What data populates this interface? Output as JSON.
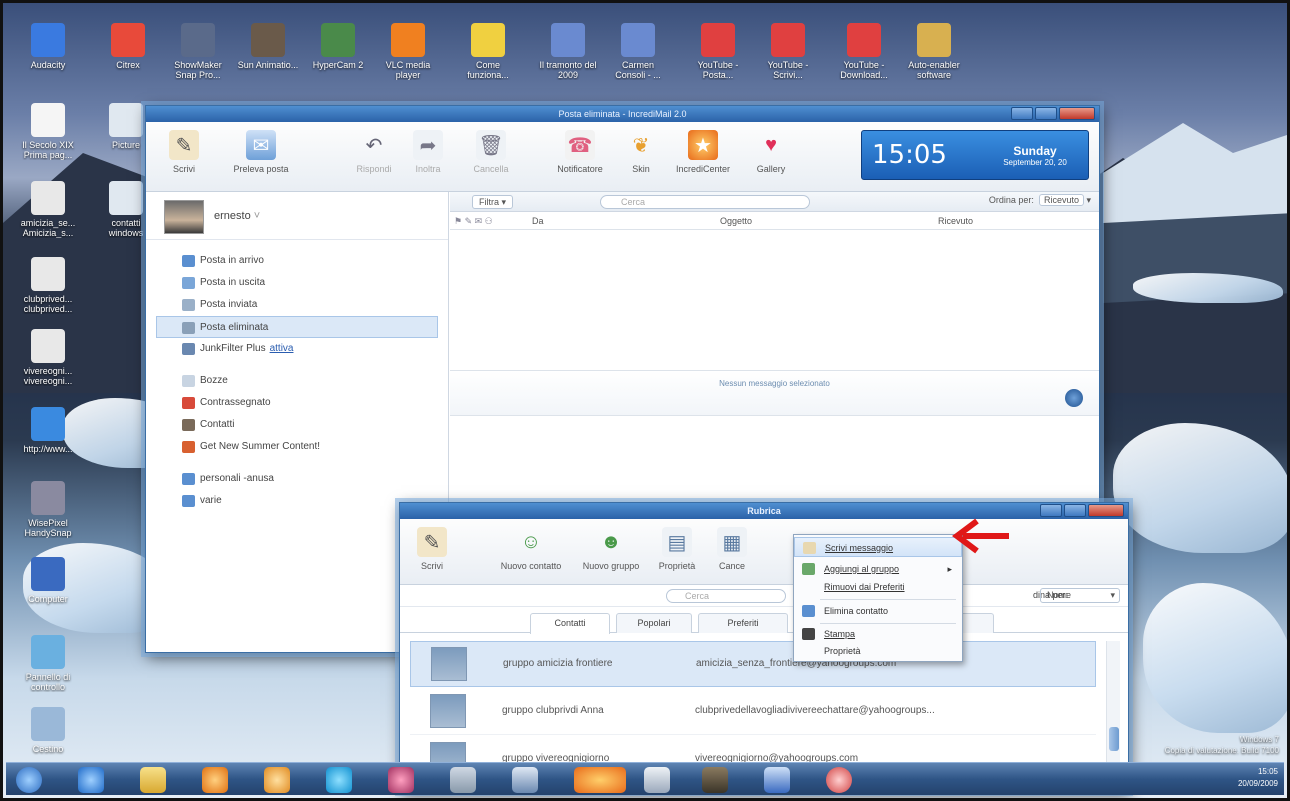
{
  "desktop_icons": [
    {
      "name": "audacity-icon",
      "label": "Audacity"
    },
    {
      "name": "citrex-icon",
      "label": "Citrex"
    },
    {
      "name": "snapshot-icon",
      "label": "ShowMaker Snap Pro..."
    },
    {
      "name": "video-icon",
      "label": "Sun Animatio..."
    },
    {
      "name": "hypercam-icon",
      "label": "HyperCam 2"
    },
    {
      "name": "vlc-icon",
      "label": "VLC media player"
    },
    {
      "name": "shortcut-1-icon",
      "label": "Come funziona..."
    },
    {
      "name": "wav-icon",
      "label": "Il tramonto del 2009"
    },
    {
      "name": "mp3-icon",
      "label": "Carmen Consoli - ..."
    },
    {
      "name": "youtube-1-icon",
      "label": "YouTube - Posta..."
    },
    {
      "name": "youtube-2-icon",
      "label": "YouTube - Scrivi..."
    },
    {
      "name": "youtube-3-icon",
      "label": "YouTube - Download..."
    },
    {
      "name": "folder-icon",
      "label": "Auto-enabler software"
    },
    {
      "name": "document-icon",
      "label": "Il Secolo XIX Prima pag..."
    },
    {
      "name": "picture-icon",
      "label": "Picture"
    },
    {
      "name": "shortcut-amicizia-icon",
      "label": "amicizia_se... Amicizia_s..."
    },
    {
      "name": "contatti-icon",
      "label": "contatti windows"
    },
    {
      "name": "clubprived-icon",
      "label": "clubprived... clubprived..."
    },
    {
      "name": "vivereogni-icon",
      "label": "vivereogni... vivereogni..."
    },
    {
      "name": "ie-icon",
      "label": "http://www..."
    },
    {
      "name": "wisepixel-icon",
      "label": "WisePixel HandySnap"
    },
    {
      "name": "computer-icon",
      "label": "Computer"
    },
    {
      "name": "control-panel-icon",
      "label": "Pannello di controllo"
    },
    {
      "name": "recycle-bin-icon",
      "label": "Cestino"
    }
  ],
  "mail_window": {
    "title": "Posta eliminata - IncrediMail 2.0",
    "toolbar": {
      "write": "Scrivi",
      "receive": "Preleva posta",
      "reply": "Rispondi",
      "forward": "Inoltra",
      "delete": "Cancella",
      "notifier": "Notificatore",
      "skin": "Skin",
      "incredicenter": "IncrediCenter",
      "gallery": "Gallery"
    },
    "clock": {
      "time": "15:05",
      "day": "Sunday",
      "date": "September 20, 20"
    },
    "account_name": "ernesto",
    "folders": [
      {
        "label": "Posta in arrivo",
        "icon": "inbox-icon",
        "color": "#5a8fd0"
      },
      {
        "label": "Posta in uscita",
        "icon": "outbox-icon",
        "color": "#7aa6d8"
      },
      {
        "label": "Posta inviata",
        "icon": "sent-icon",
        "color": "#9ab0c8"
      },
      {
        "label": "Posta eliminata",
        "icon": "trash-icon",
        "color": "#8aa0b8"
      },
      {
        "label": "JunkFilter Plus",
        "icon": "junk-icon",
        "color": "#6a88b0",
        "link": "attiva"
      }
    ],
    "folders2": [
      {
        "label": "Bozze",
        "icon": "drafts-icon",
        "color": "#c8d4e2"
      },
      {
        "label": "Contrassegnato",
        "icon": "flag-icon",
        "color": "#d84a3a"
      },
      {
        "label": "Contatti",
        "icon": "contacts-icon",
        "color": "#7a6a5a"
      },
      {
        "label": "Get New Summer Content!",
        "icon": "summer-icon",
        "color": "#d86030"
      }
    ],
    "folders3": [
      {
        "label": "personali -anusa",
        "icon": "folder-personal-icon",
        "color": "#5a8fd0"
      },
      {
        "label": "varie",
        "icon": "folder-varie-icon",
        "color": "#5a8fd0"
      }
    ],
    "filter_label": "Filtra",
    "search_placeholder": "Cerca",
    "sort_label": "Ordina per:",
    "sort_value": "Ricevuto",
    "columns": {
      "from": "Da",
      "subject": "Oggetto",
      "received": "Ricevuto"
    },
    "empty_message": "Nessun messaggio selezionato"
  },
  "address_book": {
    "title": "Rubrica",
    "toolbar": {
      "write": "Scrivi",
      "new_contact": "Nuovo contatto",
      "new_group": "Nuovo gruppo",
      "properties": "Proprietà",
      "delete": "Cance"
    },
    "search_placeholder": "Cerca",
    "sort_label": "dina per:",
    "sort_value": "Nome",
    "tabs": [
      "Contatti",
      "Popolari",
      "Preferiti"
    ],
    "contacts": [
      {
        "name": "gruppo amicizia frontiere",
        "email": "amicizia_senza_frontiere@yahoogroups.com"
      },
      {
        "name": "gruppo clubprivdi Anna",
        "email": "clubprivedellavogliadivivereechattare@yahoogroups..."
      },
      {
        "name": "gruppo vivereognigiorno",
        "email": "vivereognigiorno@yahoogroups.com"
      }
    ]
  },
  "context_menu": {
    "items": [
      {
        "label": "Scrivi messaggio",
        "icon": "write-message-icon"
      },
      {
        "label": "Aggiungi al gruppo",
        "icon": "add-group-icon"
      },
      {
        "label": "Rimuovi dai Preferiti",
        "icon": ""
      },
      {
        "label": "Elimina contatto",
        "icon": "delete-contact-icon"
      },
      {
        "label": "Stampa",
        "icon": "print-icon"
      },
      {
        "label": "Proprietà",
        "icon": ""
      }
    ]
  },
  "watermark": {
    "line1": "Windows 7",
    "line2": "Copia di valutazione. Build 7100"
  },
  "tray": {
    "time": "15:05",
    "date": "20/09/2009"
  }
}
